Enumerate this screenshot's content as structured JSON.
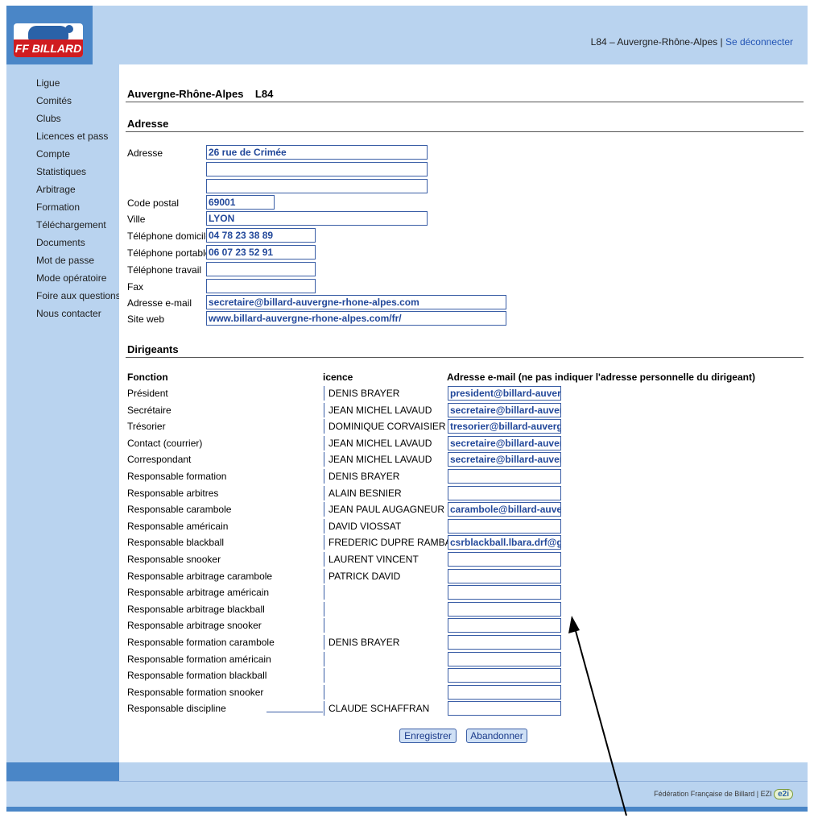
{
  "header": {
    "logo_text": "FF BILLARD",
    "org": "L84 – Auvergne-Rhône-Alpes",
    "separator": "|",
    "logout": "Se déconnecter"
  },
  "sidebar": {
    "items": [
      "Ligue",
      "Comités",
      "Clubs",
      "Licences et pass",
      "Compte",
      "Statistiques",
      "Arbitrage",
      "Formation",
      "Téléchargement",
      "Documents",
      "Mot de passe",
      "Mode opératoire",
      "Foire aux questions",
      "Nous contacter"
    ]
  },
  "page": {
    "title": "Auvergne-Rhône-Alpes    L84"
  },
  "address": {
    "section_title": "Adresse",
    "labels": {
      "adresse": "Adresse",
      "code_postal": "Code postal",
      "ville": "Ville",
      "tel_domicile": "Téléphone domicile",
      "tel_portable": "Téléphone portable",
      "tel_travail": "Téléphone travail",
      "fax": "Fax",
      "email": "Adresse e-mail",
      "site": "Site web"
    },
    "values": {
      "adresse1": "26 rue de Crimée",
      "adresse2": "",
      "adresse3": "",
      "code_postal": "69001",
      "ville": "LYON",
      "tel_domicile": "04 78 23 38 89",
      "tel_portable": "06 07 23 52 91",
      "tel_travail": "",
      "fax": "",
      "email": "secretaire@billard-auvergne-rhone-alpes.com",
      "site": "www.billard-auvergne-rhone-alpes.com/fr/"
    }
  },
  "dirigeants": {
    "section_title": "Dirigeants",
    "columns": {
      "fonction": "Fonction",
      "licence": "icence",
      "email": "Adresse e-mail (ne pas indiquer l'adresse personnelle du dirigeant)"
    },
    "rows": [
      {
        "fonction": "Président",
        "licence": "DENIS BRAYER",
        "email": "president@billard-auver"
      },
      {
        "fonction": "Secrétaire",
        "licence": "JEAN MICHEL LAVAUD",
        "email": "secretaire@billard-auver"
      },
      {
        "fonction": "Trésorier",
        "licence": "DOMINIQUE CORVAISIER",
        "email": "tresorier@billard-auverg"
      },
      {
        "fonction": "Contact (courrier)",
        "licence": "JEAN MICHEL LAVAUD",
        "email": "secretaire@billard-auver"
      },
      {
        "fonction": "Correspondant",
        "licence": "JEAN MICHEL LAVAUD",
        "email": "secretaire@billard-auver"
      },
      {
        "fonction": "Responsable formation",
        "licence": "DENIS BRAYER",
        "email": ""
      },
      {
        "fonction": "Responsable arbitres",
        "licence": "ALAIN BESNIER",
        "email": ""
      },
      {
        "fonction": "Responsable carambole",
        "licence": "JEAN PAUL AUGAGNEUR",
        "email": "carambole@billard-auve"
      },
      {
        "fonction": "Responsable américain",
        "licence": "DAVID VIOSSAT",
        "email": ""
      },
      {
        "fonction": "Responsable blackball",
        "licence": "FREDERIC DUPRE RAMBAUD",
        "email": "csrblackball.lbara.drf@g"
      },
      {
        "fonction": "Responsable snooker",
        "licence": "LAURENT VINCENT",
        "email": ""
      },
      {
        "fonction": "Responsable arbitrage carambole",
        "licence": "PATRICK DAVID",
        "email": ""
      },
      {
        "fonction": "Responsable arbitrage américain",
        "licence": "",
        "email": ""
      },
      {
        "fonction": "Responsable arbitrage blackball",
        "licence": "",
        "email": ""
      },
      {
        "fonction": "Responsable arbitrage snooker",
        "licence": "",
        "email": ""
      },
      {
        "fonction": "Responsable formation carambole",
        "licence": "DENIS BRAYER",
        "email": ""
      },
      {
        "fonction": "Responsable formation américain",
        "licence": "",
        "email": ""
      },
      {
        "fonction": "Responsable formation blackball",
        "licence": "",
        "email": ""
      },
      {
        "fonction": "Responsable formation snooker",
        "licence": "",
        "email": ""
      },
      {
        "fonction": "Responsable discipline",
        "licence": "CLAUDE SCHAFFRAN",
        "email": ""
      }
    ]
  },
  "actions": {
    "save": "Enregistrer",
    "cancel": "Abandonner"
  },
  "footer": {
    "text": "Fédération Française de Billard | EZI",
    "badge": "e2i"
  },
  "colors": {
    "frame": "#4a86c7",
    "panel": "#b9d3ef",
    "link": "#2455b5",
    "input_text": "#22489a",
    "logo_red": "#d01c20"
  }
}
